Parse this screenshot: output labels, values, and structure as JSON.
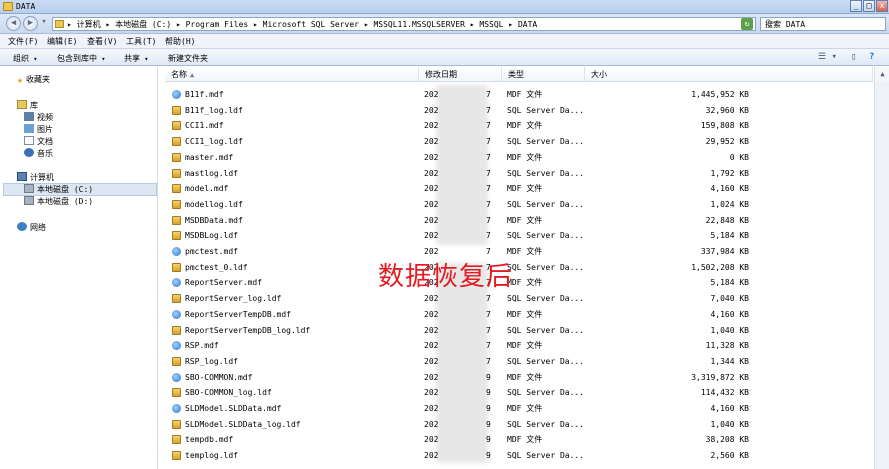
{
  "window": {
    "title": "DATA",
    "buttons": [
      "_",
      "□",
      "x"
    ]
  },
  "address": {
    "breadcrumb": "▸ 计算机 ▸ 本地磁盘 (C:) ▸ Program Files ▸ Microsoft SQL Server ▸ MSSQL11.MSSQLSERVER ▸ MSSQL ▸ DATA",
    "search_placeholder": "搜索 DATA"
  },
  "menu": [
    "文件(F)",
    "编辑(E)",
    "查看(V)",
    "工具(T)",
    "帮助(H)"
  ],
  "toolbar": {
    "organize": "组织",
    "include": "包含到库中",
    "share": "共享",
    "new_folder": "新建文件夹"
  },
  "nav": {
    "favorites": "收藏夹",
    "library": "库",
    "library_items": [
      "视频",
      "图片",
      "文档",
      "音乐"
    ],
    "computer": "计算机",
    "drives": [
      "本地磁盘 (C:)",
      "本地磁盘 (D:)"
    ],
    "network": "网络"
  },
  "columns": {
    "name": "名称",
    "date": "修改日期",
    "type": "类型",
    "size": "大小"
  },
  "files": [
    {
      "name": "B11f.mdf",
      "date_prefix": "202",
      "date_suffix": "7",
      "type": "MDF 文件",
      "size": "1,445,952 KB",
      "icon": "mdf-icon"
    },
    {
      "name": "B11f_log.ldf",
      "date_prefix": "202",
      "date_suffix": "7",
      "type": "SQL Server Da...",
      "size": "32,960 KB",
      "icon": "ldf-icon"
    },
    {
      "name": "CCI1.mdf",
      "date_prefix": "202",
      "date_suffix": "7",
      "type": "MDF 文件",
      "size": "159,808 KB",
      "icon": "ldf-icon"
    },
    {
      "name": "CCI1_log.ldf",
      "date_prefix": "202",
      "date_suffix": "7",
      "type": "SQL Server Da...",
      "size": "29,952 KB",
      "icon": "ldf-icon"
    },
    {
      "name": "master.mdf",
      "date_prefix": "202",
      "date_suffix": "7",
      "type": "MDF 文件",
      "size": "0 KB",
      "icon": "ldf-icon"
    },
    {
      "name": "mastlog.ldf",
      "date_prefix": "202",
      "date_suffix": "7",
      "type": "SQL Server Da...",
      "size": "1,792 KB",
      "icon": "ldf-icon"
    },
    {
      "name": "model.mdf",
      "date_prefix": "202",
      "date_suffix": "7",
      "type": "MDF 文件",
      "size": "4,160 KB",
      "icon": "ldf-icon"
    },
    {
      "name": "modellog.ldf",
      "date_prefix": "202",
      "date_suffix": "7",
      "type": "SQL Server Da...",
      "size": "1,024 KB",
      "icon": "ldf-icon"
    },
    {
      "name": "MSDBData.mdf",
      "date_prefix": "202",
      "date_suffix": "7",
      "type": "MDF 文件",
      "size": "22,848 KB",
      "icon": "ldf-icon"
    },
    {
      "name": "MSDBLog.ldf",
      "date_prefix": "202",
      "date_suffix": "7",
      "type": "SQL Server Da...",
      "size": "5,184 KB",
      "icon": "ldf-icon"
    },
    {
      "name": "pmctest.mdf",
      "date_prefix": "202",
      "date_suffix": "7",
      "type": "MDF 文件",
      "size": "337,984 KB",
      "icon": "mdf-icon"
    },
    {
      "name": "pmctest_0.ldf",
      "date_prefix": "202",
      "date_suffix": "7",
      "type": "SQL Server Da...",
      "size": "1,502,208 KB",
      "icon": "ldf-icon"
    },
    {
      "name": "ReportServer.mdf",
      "date_prefix": "202",
      "date_suffix": "7",
      "type": "MDF 文件",
      "size": "5,184 KB",
      "icon": "mdf-icon"
    },
    {
      "name": "ReportServer_log.ldf",
      "date_prefix": "202",
      "date_suffix": "7",
      "type": "SQL Server Da...",
      "size": "7,040 KB",
      "icon": "ldf-icon"
    },
    {
      "name": "ReportServerTempDB.mdf",
      "date_prefix": "202",
      "date_suffix": "7",
      "type": "MDF 文件",
      "size": "4,160 KB",
      "icon": "mdf-icon"
    },
    {
      "name": "ReportServerTempDB_log.ldf",
      "date_prefix": "202",
      "date_suffix": "7",
      "type": "SQL Server Da...",
      "size": "1,040 KB",
      "icon": "ldf-icon"
    },
    {
      "name": "RSP.mdf",
      "date_prefix": "202",
      "date_suffix": "7",
      "type": "MDF 文件",
      "size": "11,328 KB",
      "icon": "mdf-icon"
    },
    {
      "name": "RSP_log.ldf",
      "date_prefix": "202",
      "date_suffix": "7",
      "type": "SQL Server Da...",
      "size": "1,344 KB",
      "icon": "ldf-icon"
    },
    {
      "name": "SBO-COMMON.mdf",
      "date_prefix": "202",
      "date_suffix": "9",
      "type": "MDF 文件",
      "size": "3,319,872 KB",
      "icon": "mdf-icon"
    },
    {
      "name": "SBO-COMMON_log.ldf",
      "date_prefix": "202",
      "date_suffix": "9",
      "type": "SQL Server Da...",
      "size": "114,432 KB",
      "icon": "ldf-icon"
    },
    {
      "name": "SLDModel.SLDData.mdf",
      "date_prefix": "202",
      "date_suffix": "9",
      "type": "MDF 文件",
      "size": "4,160 KB",
      "icon": "mdf-icon"
    },
    {
      "name": "SLDModel.SLDData_log.ldf",
      "date_prefix": "202",
      "date_suffix": "9",
      "type": "SQL Server Da...",
      "size": "1,040 KB",
      "icon": "ldf-icon"
    },
    {
      "name": "tempdb.mdf",
      "date_prefix": "202",
      "date_suffix": "9",
      "type": "MDF 文件",
      "size": "38,208 KB",
      "icon": "ldf-icon"
    },
    {
      "name": "templog.ldf",
      "date_prefix": "202",
      "date_suffix": "9",
      "type": "SQL Server Da...",
      "size": "2,560 KB",
      "icon": "ldf-icon"
    }
  ],
  "watermark": "数据恢复后"
}
